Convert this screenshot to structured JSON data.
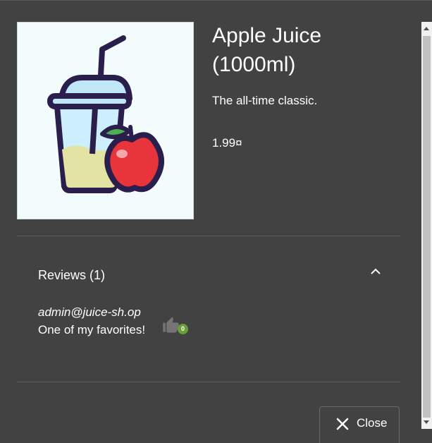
{
  "product": {
    "name": "Apple Juice (1000ml)",
    "description": "The all-time classic.",
    "price": "1.99¤",
    "image_icon": "apple-juice-image"
  },
  "reviews": {
    "title": "Reviews (1)",
    "expanded": true,
    "items": [
      {
        "author": "admin@juice-sh.op",
        "message": "One of my favorites!",
        "likes": "0"
      }
    ]
  },
  "actions": {
    "close_label": "Close"
  },
  "colors": {
    "background": "#424242",
    "like_badge": "#689f38"
  }
}
